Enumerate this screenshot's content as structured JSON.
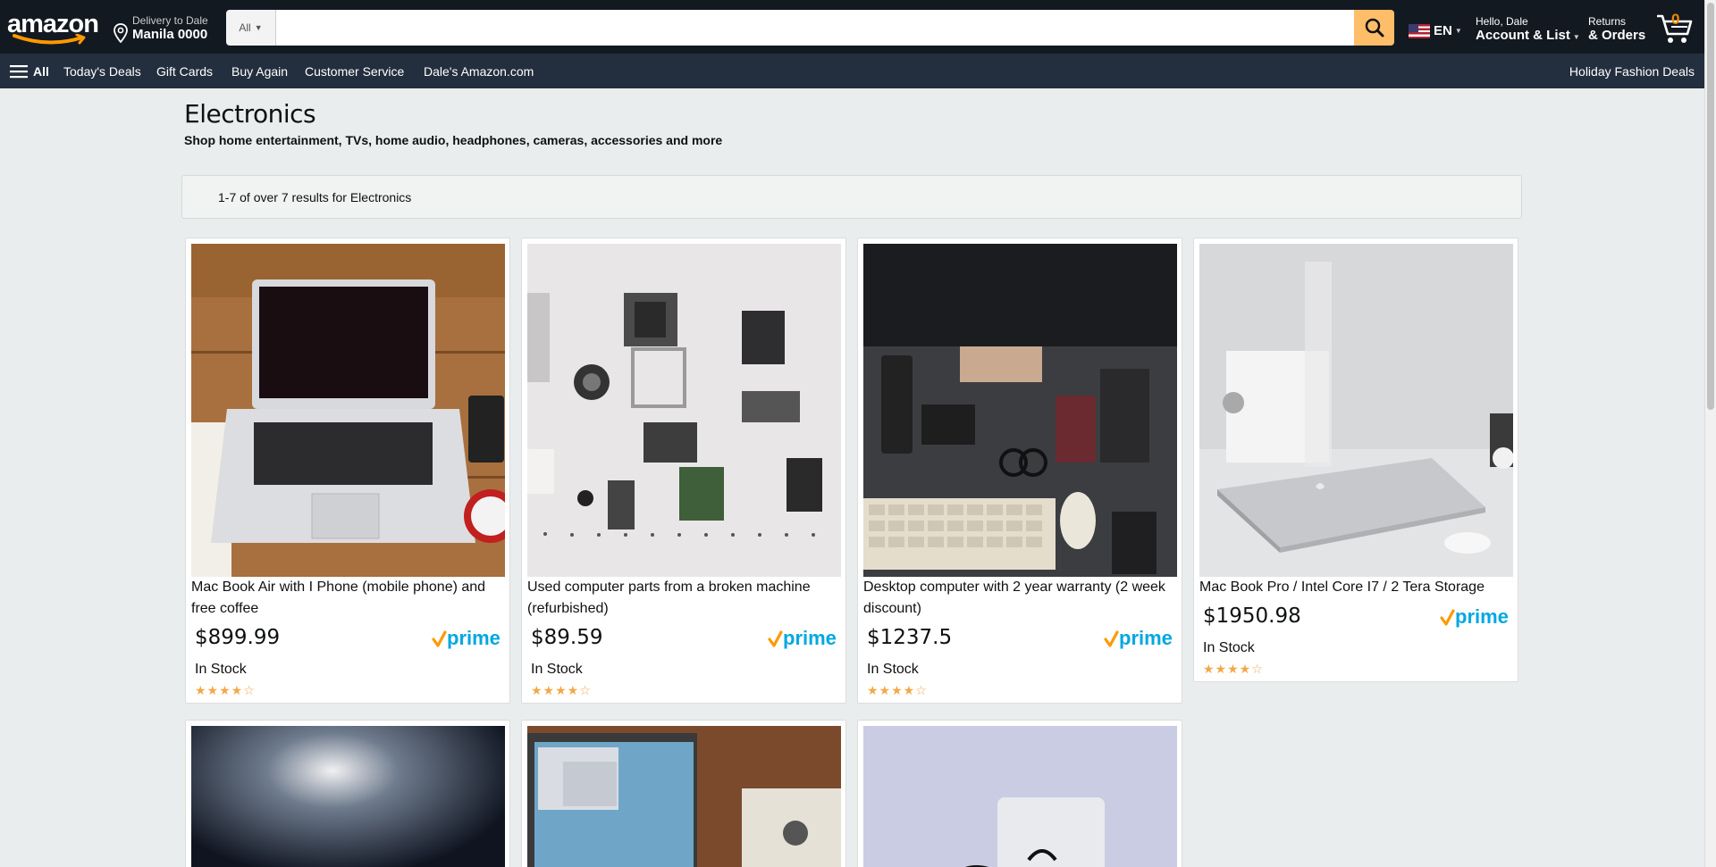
{
  "header": {
    "logo": "amazon",
    "deliver_line1": "Delivery to Dale",
    "deliver_line2": "Manila 0000",
    "search_category": "All",
    "search_placeholder": "",
    "lang": "EN",
    "account_line1": "Hello, Dale",
    "account_line2": "Account & List",
    "returns_line1": "Returns",
    "returns_line2": "& Orders",
    "cart_count": "0"
  },
  "subnav": {
    "all": "All",
    "items": [
      "Today's Deals",
      "Gift Cards",
      "Buy Again",
      "Customer Service",
      "Dale's Amazon.com"
    ],
    "right": "Holiday Fashion Deals"
  },
  "main": {
    "title": "Electronics",
    "subtitle": "Shop home entertainment, TVs, home audio, headphones, cameras, accessories and more",
    "results": "1-7 of over 7 results for Electronics"
  },
  "products": [
    {
      "title": "Mac Book Air with I Phone (mobile phone) and free coffee",
      "price": "$899.99",
      "stock": "In Stock",
      "rating": 4,
      "prime": "prime"
    },
    {
      "title": "Used computer parts from a broken machine (refurbished)",
      "price": "$89.59",
      "stock": "In Stock",
      "rating": 4,
      "prime": "prime"
    },
    {
      "title": "Desktop computer with 2 year warranty (2 week discount)",
      "price": "$1237.5",
      "stock": "In Stock",
      "rating": 4,
      "prime": "prime"
    },
    {
      "title": "Mac Book Pro / Intel Core I7 / 2 Tera Storage",
      "price": "$1950.98",
      "stock": "In Stock",
      "rating": 4,
      "prime": "prime"
    }
  ],
  "colors": {
    "header_bg": "#131921",
    "subnav_bg": "#232f3e",
    "search_button": "#febd69",
    "star": "#f3a847",
    "prime_blue": "#00a8e1"
  }
}
